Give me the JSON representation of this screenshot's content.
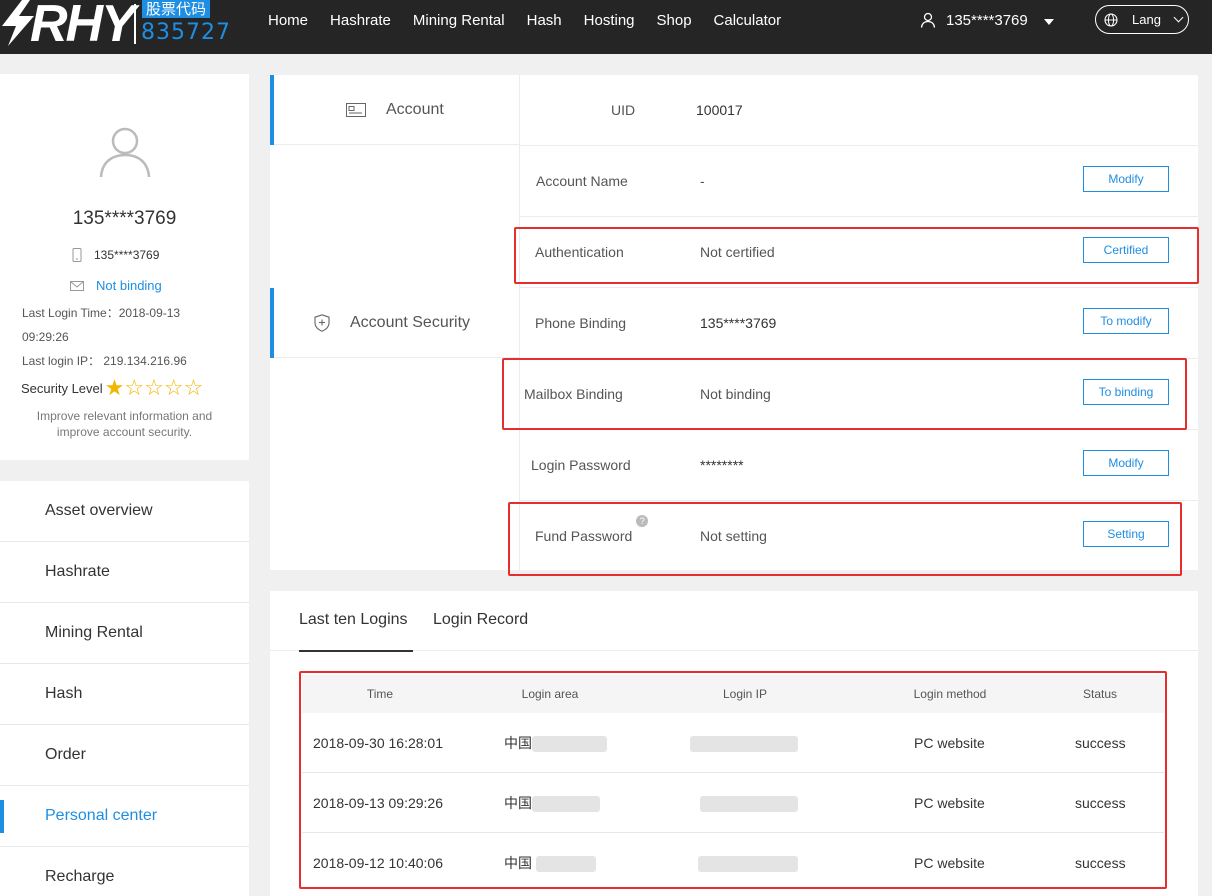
{
  "brand": {
    "logo_text": "RHY",
    "cn_label": "股票代码",
    "stock_code": "835727"
  },
  "nav": [
    "Home",
    "Hashrate",
    "Mining Rental",
    "Hash",
    "Hosting",
    "Shop",
    "Calculator"
  ],
  "header_user": "135****3769",
  "lang_label": "Lang",
  "profile": {
    "name": "135****3769",
    "phone": "135****3769",
    "mail_status": "Not binding",
    "last_login_time_label": "Last Login Time：2018-09-13",
    "last_login_time_cont": "09:29:26",
    "last_login_ip": "Last login IP： 219.134.216.96",
    "security_label": "Security Level",
    "security_level": 1,
    "security_max": 5,
    "tip_line1": "Improve relevant information and",
    "tip_line2": "improve account security."
  },
  "menu": [
    "Asset overview",
    "Hashrate",
    "Mining Rental",
    "Hash",
    "Order",
    "Personal center",
    "Recharge"
  ],
  "menu_active": "Personal center",
  "account": {
    "section_account": "Account",
    "section_security": "Account Security",
    "uid_label": "UID",
    "uid_value": "100017",
    "rows": [
      {
        "label": "Account Name",
        "value": "-",
        "button": "Modify"
      },
      {
        "label": "Authentication",
        "value": "Not certified",
        "button": "Certified"
      },
      {
        "label": "Phone Binding",
        "value": "135****3769",
        "button": "To modify"
      },
      {
        "label": "Mailbox Binding",
        "value": "Not binding",
        "button": "To binding"
      },
      {
        "label": "Login Password",
        "value": "********",
        "button": "Modify"
      },
      {
        "label": "Fund Password",
        "value": "Not setting",
        "button": "Setting"
      }
    ]
  },
  "logins": {
    "tabs": [
      "Last ten Logins",
      "Login Record"
    ],
    "columns": [
      "Time",
      "Login area",
      "Login IP",
      "Login method",
      "Status"
    ],
    "rows": [
      {
        "time": "2018-09-30 16:28:01",
        "area": "中国",
        "method": "PC website",
        "status": "success"
      },
      {
        "time": "2018-09-13 09:29:26",
        "area": "中国",
        "method": "PC website",
        "status": "success"
      },
      {
        "time": "2018-09-12 10:40:06",
        "area": "中国",
        "method": "PC website",
        "status": "success"
      }
    ]
  },
  "colors": {
    "accent": "#1e8ee3",
    "highlight": "#e62e2e",
    "topbar": "#252525",
    "star": "#f2b600"
  }
}
